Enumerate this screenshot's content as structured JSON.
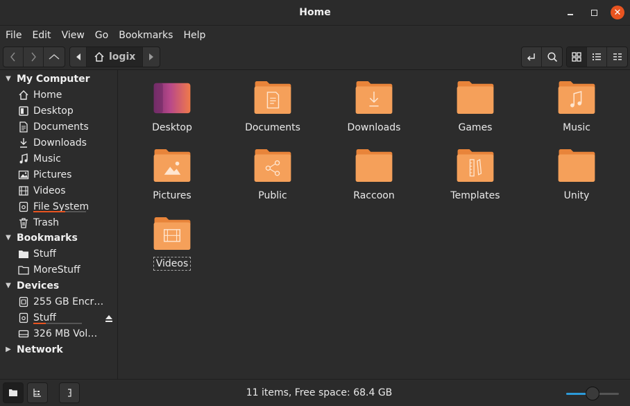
{
  "window": {
    "title": "Home"
  },
  "menubar": {
    "items": [
      "File",
      "Edit",
      "View",
      "Go",
      "Bookmarks",
      "Help"
    ]
  },
  "toolbar": {
    "back_icon": "chevron-left-icon",
    "forward_icon": "chevron-right-icon",
    "up_icon": "chevron-up-icon",
    "path_location": "logix",
    "toggle_location_icon": "enter-path-icon",
    "search_icon": "search-icon",
    "views": [
      "icon-view",
      "list-view",
      "compact-view"
    ],
    "active_view": "icon-view"
  },
  "sidebar": {
    "sections": [
      {
        "label": "My Computer",
        "expanded": true
      },
      {
        "label": "Bookmarks",
        "expanded": true
      },
      {
        "label": "Devices",
        "expanded": true
      },
      {
        "label": "Network",
        "expanded": false
      }
    ],
    "my_computer": [
      {
        "label": "Home",
        "icon": "home-icon"
      },
      {
        "label": "Desktop",
        "icon": "desktop-icon"
      },
      {
        "label": "Documents",
        "icon": "documents-icon"
      },
      {
        "label": "Downloads",
        "icon": "downloads-icon"
      },
      {
        "label": "Music",
        "icon": "music-icon"
      },
      {
        "label": "Pictures",
        "icon": "pictures-icon"
      },
      {
        "label": "Videos",
        "icon": "videos-icon"
      },
      {
        "label": "File System",
        "icon": "drive-icon",
        "usage": 0.6
      },
      {
        "label": "Trash",
        "icon": "trash-icon"
      }
    ],
    "bookmarks": [
      {
        "label": "Stuff",
        "icon": "folder-icon"
      },
      {
        "label": "MoreStuff",
        "icon": "folder-icon"
      }
    ],
    "devices": [
      {
        "label": "255 GB Encr…",
        "icon": "encrypted-drive-icon"
      },
      {
        "label": "Stuff",
        "icon": "drive-icon",
        "usage": 0.25,
        "ejectable": true
      },
      {
        "label": "326 MB Vol…",
        "icon": "harddisk-icon"
      }
    ]
  },
  "files": [
    {
      "name": "Desktop",
      "icon": "desktop-folder-icon"
    },
    {
      "name": "Documents",
      "icon": "documents-folder-icon"
    },
    {
      "name": "Downloads",
      "icon": "downloads-folder-icon"
    },
    {
      "name": "Games",
      "icon": "folder-icon"
    },
    {
      "name": "Music",
      "icon": "music-folder-icon"
    },
    {
      "name": "Pictures",
      "icon": "pictures-folder-icon"
    },
    {
      "name": "Public",
      "icon": "public-folder-icon"
    },
    {
      "name": "Raccoon",
      "icon": "folder-icon"
    },
    {
      "name": "Templates",
      "icon": "templates-folder-icon"
    },
    {
      "name": "Unity",
      "icon": "folder-icon"
    },
    {
      "name": "Videos",
      "icon": "videos-folder-icon",
      "focused": true
    }
  ],
  "statusbar": {
    "text": "11 items, Free space: 68.4 GB",
    "zoom_level": 0.5
  },
  "colors": {
    "accent": "#e95420",
    "folder": "#f5a05a",
    "folder_dark": "#e8843a",
    "selection_blue": "#2c9ad8"
  }
}
